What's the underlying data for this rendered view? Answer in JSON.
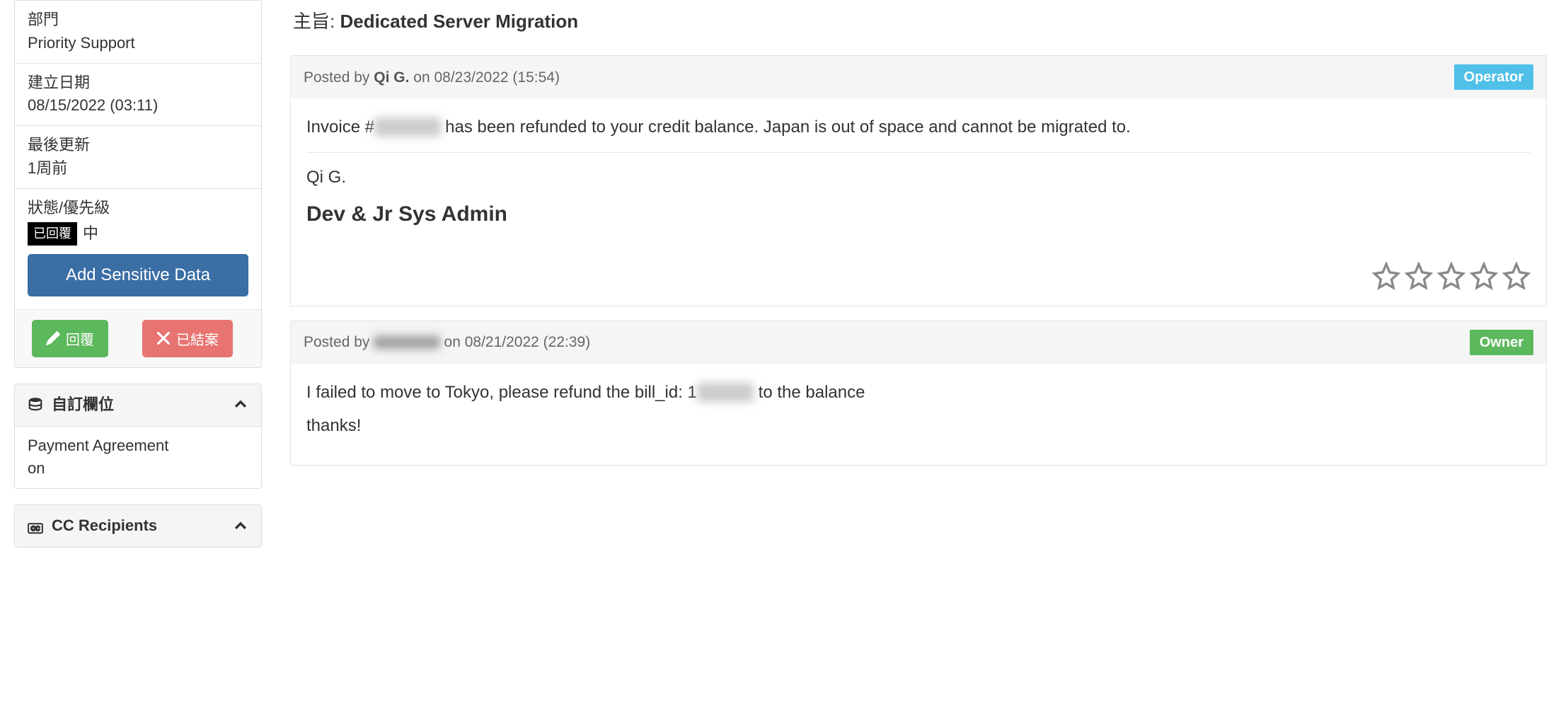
{
  "sidebar": {
    "department_label": "部門",
    "department_value": "Priority Support",
    "created_label": "建立日期",
    "created_value": "08/15/2022 (03:11)",
    "updated_label": "最後更新",
    "updated_value": "1周前",
    "status_label": "狀態/優先級",
    "status_badge": "已回覆",
    "status_priority": "中",
    "add_sensitive_label": "Add Sensitive Data",
    "reply_label": "回覆",
    "close_label": "已結案",
    "custom_fields_header": "自訂欄位",
    "custom_field_name": "Payment Agreement",
    "custom_field_value": "on",
    "cc_header": "CC Recipients"
  },
  "ticket": {
    "subject_label": "主旨:",
    "subject_value": "Dedicated Server Migration"
  },
  "posts": [
    {
      "prefix": "Posted by",
      "author": "Qi G.",
      "timestamp": "on 08/23/2022 (15:54)",
      "role_label": "Operator",
      "role_class": "role-operator",
      "body_line1_a": "Invoice #",
      "body_line1_redacted": "0000000",
      "body_line1_b": " has been refunded to your credit balance. Japan is out of space and cannot be migrated to.",
      "signature_name": "Qi G.",
      "signature_title": "Dev & Jr Sys Admin"
    },
    {
      "prefix": "Posted by",
      "author_redacted": "xxxxxxxx",
      "timestamp": "on 08/21/2022 (22:39)",
      "role_label": "Owner",
      "role_class": "role-owner",
      "body_line1_a": "I failed to move to Tokyo, please refund the bill_id: 1",
      "body_line1_redacted": "000000",
      "body_line1_b": " to the balance",
      "body_line2": "thanks!"
    }
  ]
}
